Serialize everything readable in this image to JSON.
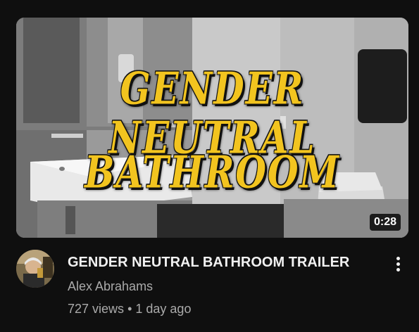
{
  "video": {
    "thumbnail_text_line1": "GENDER NEUTRAL",
    "thumbnail_text_line2": "BATHROOM",
    "duration": "0:28",
    "title": "GENDER NEUTRAL BATHROOM TRAILER",
    "channel": "Alex Abrahams",
    "views": "727 views",
    "separator": "•",
    "age": "1 day ago"
  },
  "icons": {
    "more": "vertical-dots-icon"
  },
  "colors": {
    "background": "#0f0f0f",
    "title_text": "#f1f1f1",
    "secondary_text": "#aaaaaa",
    "thumbnail_title": "#f2c41f"
  }
}
